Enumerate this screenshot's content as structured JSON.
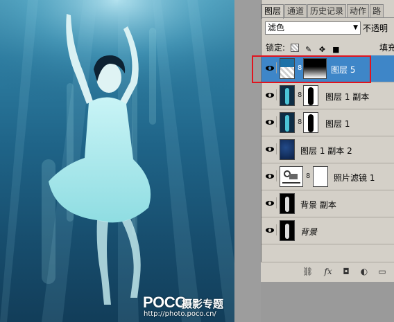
{
  "photo": {
    "watermark_brand": "POCO",
    "watermark_cn": "摄影专题",
    "watermark_url": "http://photo.poco.cn/"
  },
  "panel": {
    "tabs": [
      "图层",
      "通道",
      "历史记录",
      "动作",
      "路"
    ],
    "active_tab": "图层",
    "blend_mode": "滤色",
    "opacity_label": "不透明",
    "lock_label": "锁定:",
    "fill_label": "填充",
    "layers": [
      {
        "name": "图层 5",
        "selected": true,
        "visible": true
      },
      {
        "name": "图层 1 副本",
        "selected": false,
        "visible": true
      },
      {
        "name": "图层 1",
        "selected": false,
        "visible": true
      },
      {
        "name": "图层 1 副本 2",
        "selected": false,
        "visible": true
      },
      {
        "name": "照片滤镜 1",
        "selected": false,
        "visible": true
      },
      {
        "name": "背景 副本",
        "selected": false,
        "visible": true
      },
      {
        "name": "背景",
        "selected": false,
        "visible": true
      }
    ]
  },
  "colors": {
    "selection": "#3e86c8",
    "highlight_box": "#e0141e",
    "panel_bg": "#d4d0c8"
  }
}
